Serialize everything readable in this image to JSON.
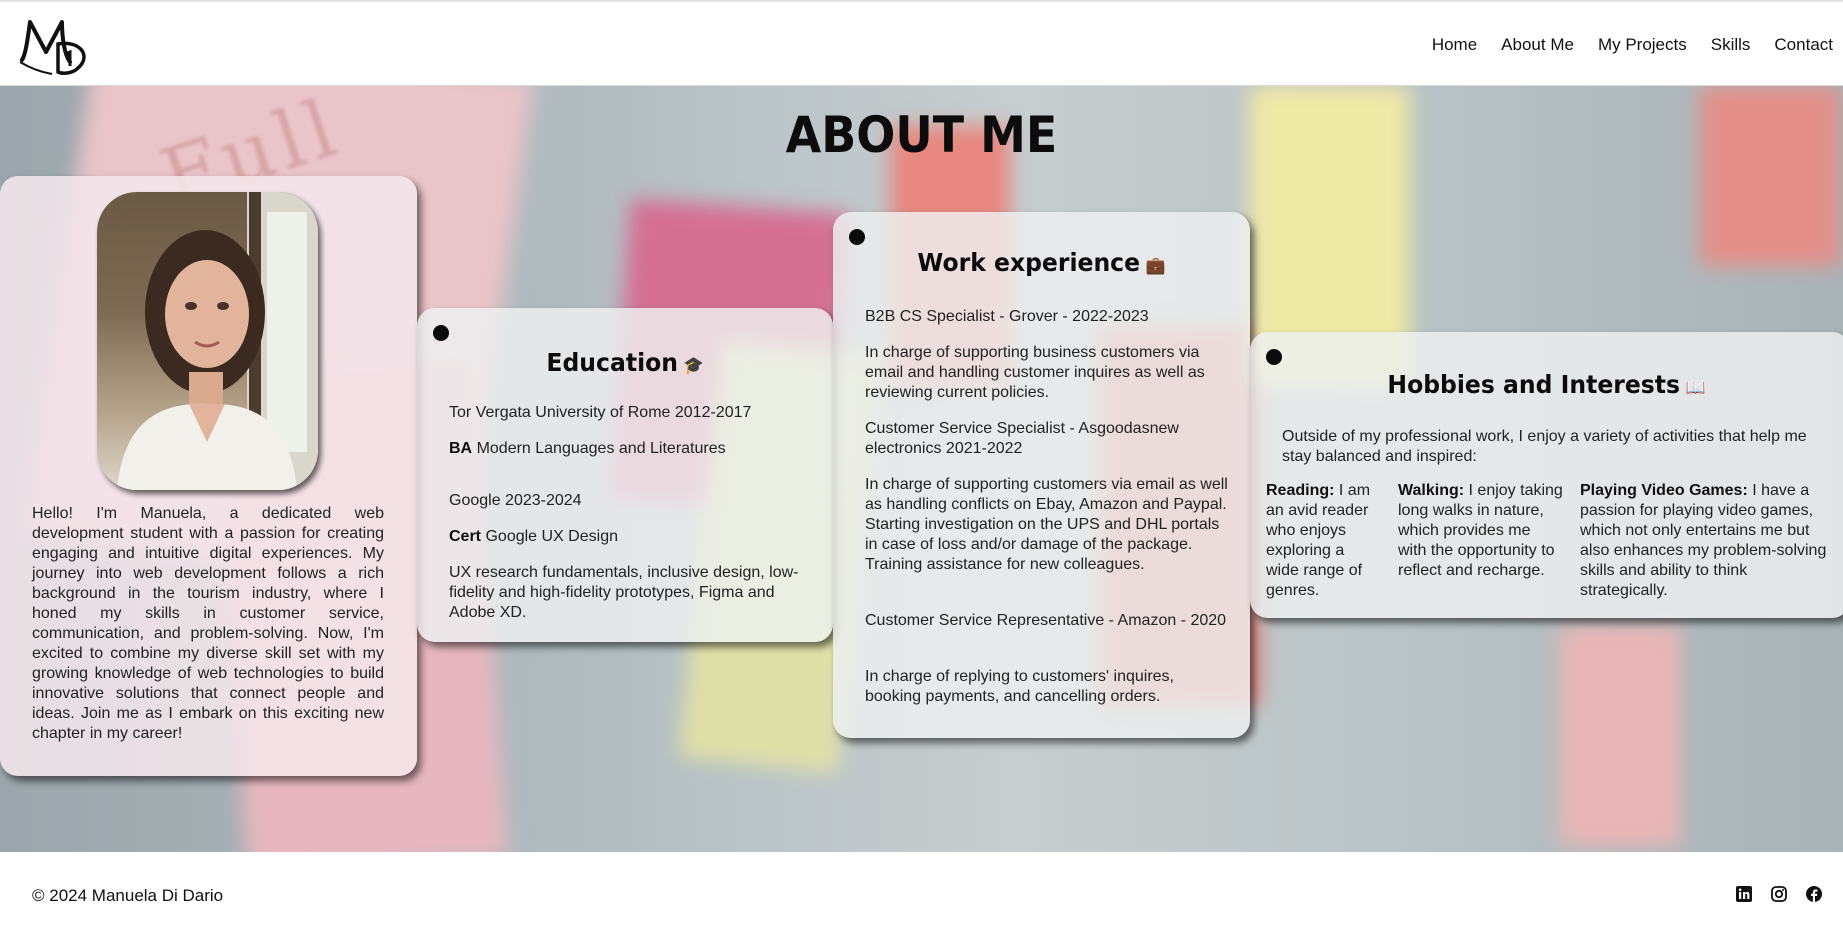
{
  "header": {
    "nav": [
      "Home",
      "About Me",
      "My Projects",
      "Skills",
      "Contact"
    ]
  },
  "hero": {
    "title": "About me",
    "background_note_text": "Full"
  },
  "intro": {
    "text": "Hello! I'm Manuela, a dedicated web development student with a passion for creating engaging and intuitive digital experiences. My journey into web development follows a rich background in the tourism industry, where I honed my skills in customer service, communication, and problem-solving. Now, I'm excited to combine my diverse skill set with my growing knowledge of web technologies to build innovative solutions that connect people and ideas. Join me as I embark on this exciting new chapter in my career!"
  },
  "education": {
    "title": "Education",
    "icon": "graduation-cap-icon",
    "school_line": "Tor Vergata University of Rome 2012-2017",
    "degree_label": "BA",
    "degree_text": "Modern Languages and Literatures",
    "cert_org_line": "Google 2023-2024",
    "cert_label": "Cert",
    "cert_text": "Google UX Design",
    "cert_description": "UX research fundamentals, inclusive design, low-fidelity and high-fidelity prototypes, Figma and Adobe XD."
  },
  "work": {
    "title": "Work experience",
    "icon": "briefcase-icon",
    "jobs": [
      {
        "role": "B2B CS Specialist - Grover - 2022-2023",
        "description": "In charge of supporting business customers via email and handling customer inquires as well as reviewing current policies."
      },
      {
        "role": "Customer Service Specialist - Asgoodasnew electronics 2021-2022",
        "description": "In charge of supporting customers via email as well as handling conflicts on Ebay, Amazon and Paypal. Starting investigation on the UPS and DHL portals in case of loss and/or damage of the package. Training assistance for new colleagues."
      },
      {
        "role": "Customer Service Representative - Amazon - 2020",
        "description": "In charge of replying to customers' inquires, booking payments, and cancelling orders."
      }
    ]
  },
  "hobbies": {
    "title": "Hobbies and Interests",
    "icon": "open-book-icon",
    "intro": "Outside of my professional work, I enjoy a variety of activities that help me stay balanced and inspired:",
    "items": [
      {
        "label": "Reading:",
        "text": "I am an avid reader who enjoys exploring a wide range of genres."
      },
      {
        "label": "Walking:",
        "text": "I enjoy taking long walks in nature, which provides me with the opportunity to reflect and recharge."
      },
      {
        "label": "Playing Video Games:",
        "text": "I have a passion for playing video games, which not only entertains me but also enhances my problem-solving skills and ability to think strategically."
      }
    ]
  },
  "footer": {
    "copyright": "© 2024 Manuela Di Dario",
    "social": [
      "linkedin-icon",
      "instagram-icon",
      "facebook-icon"
    ]
  },
  "colors": {
    "pin": "#0b0b0b",
    "card": "#eef0f0",
    "text": "#222222"
  }
}
